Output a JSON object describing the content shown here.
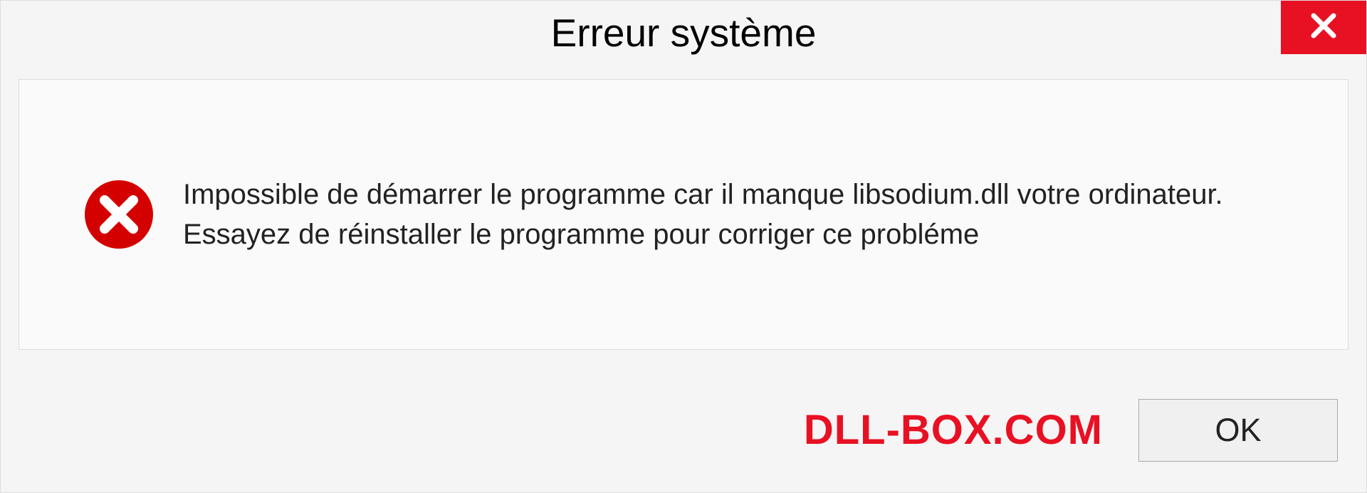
{
  "dialog": {
    "title": "Erreur système",
    "message": "Impossible de démarrer le programme car il manque libsodium.dll votre ordinateur. Essayez de réinstaller le programme pour corriger ce probléme",
    "ok_label": "OK"
  },
  "watermark": "DLL-BOX.COM",
  "colors": {
    "close_red": "#e81123",
    "error_red": "#d40000"
  }
}
